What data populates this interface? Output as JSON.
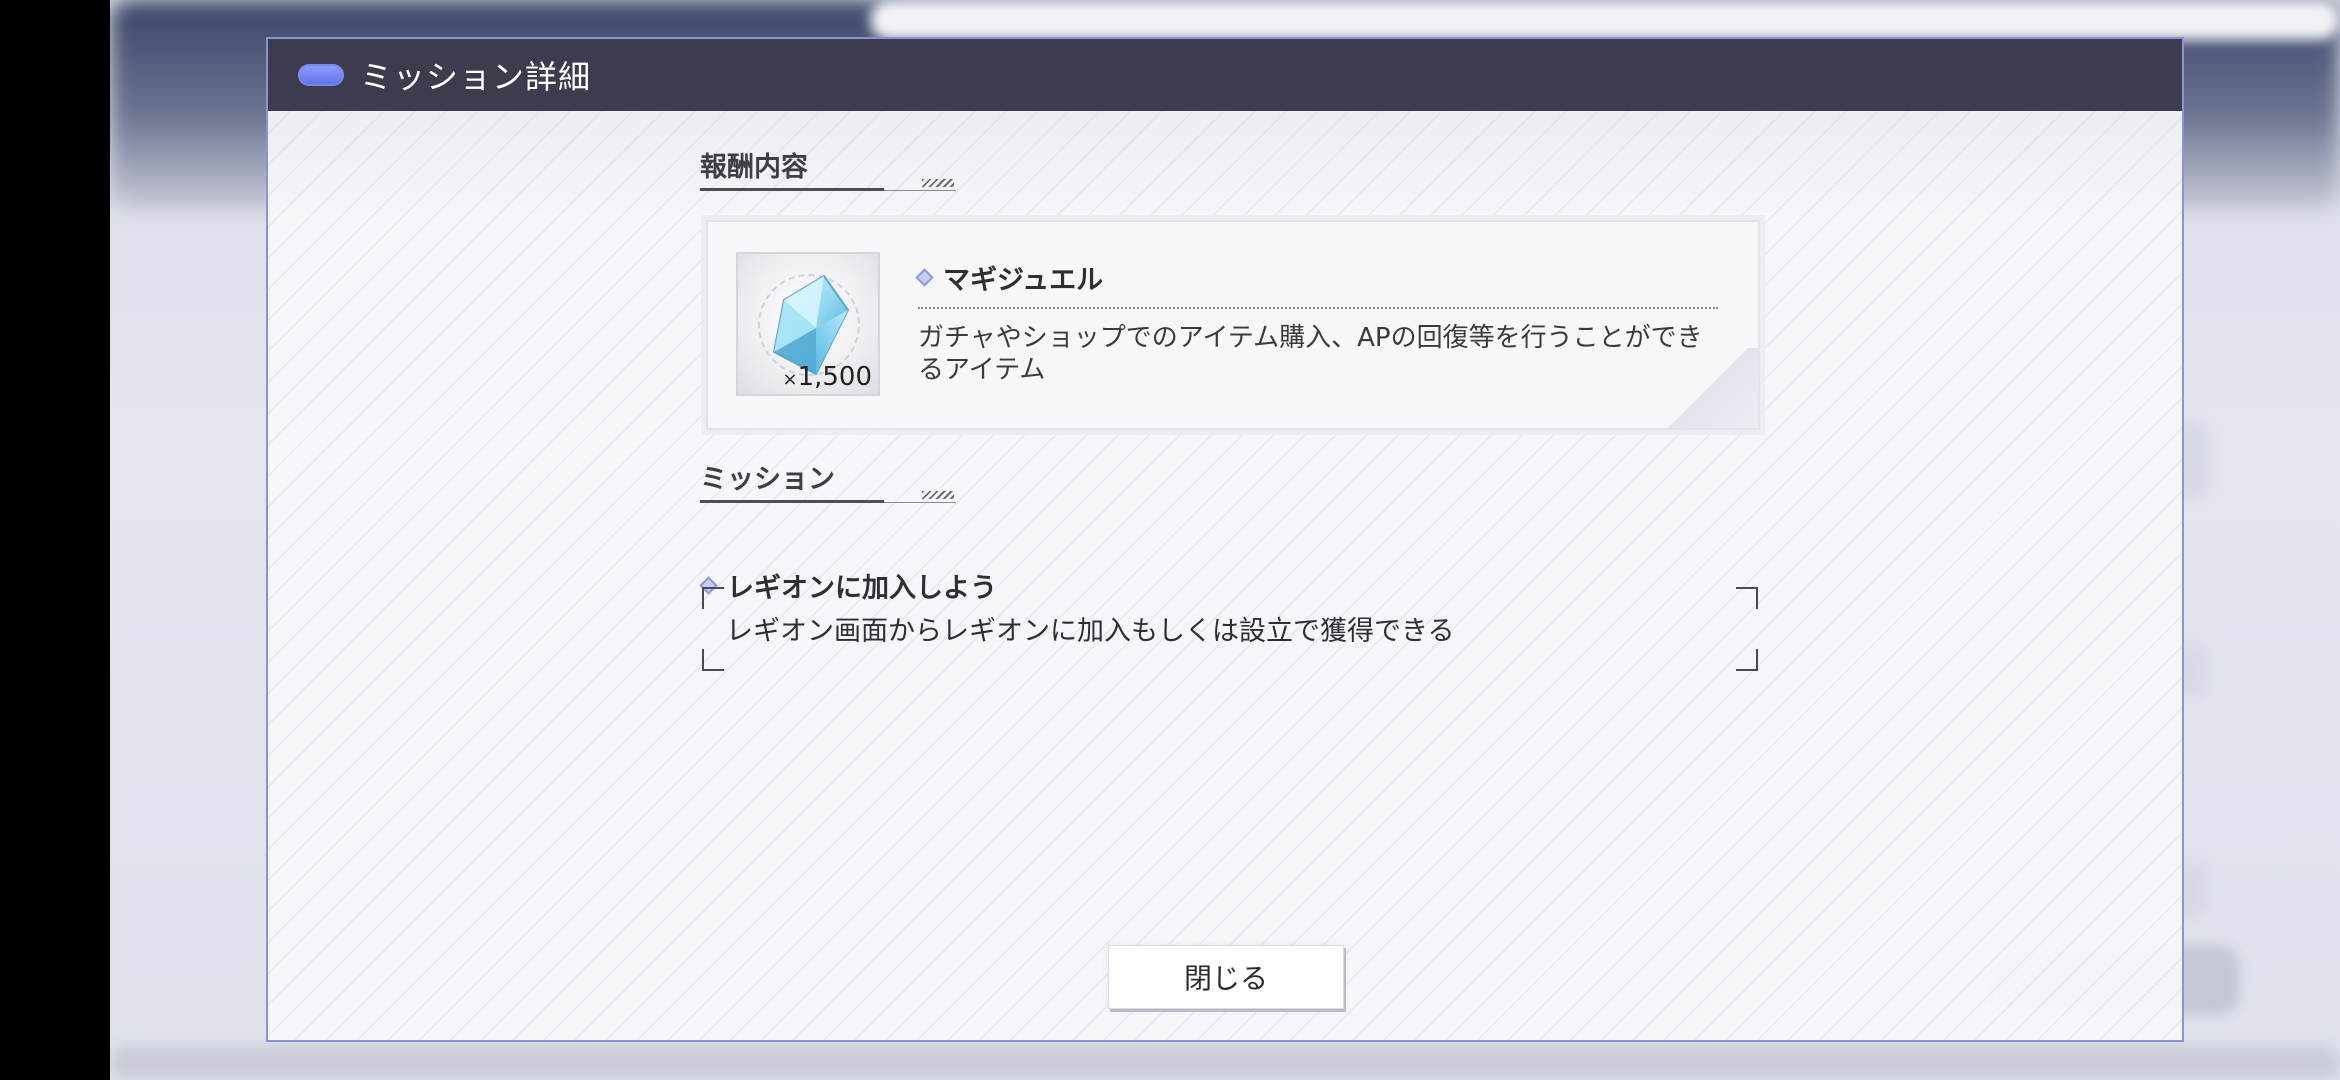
{
  "dialog": {
    "title": "ミッション詳細"
  },
  "reward_section": {
    "heading": "報酬内容",
    "item": {
      "icon": "crystal-gem-icon",
      "quantity": "1,500",
      "quantity_prefix": "×",
      "name": "マギジュエル",
      "description": "ガチャやショップでのアイテム購入、APの回復等を行うことができるアイテム"
    }
  },
  "mission_section": {
    "heading": "ミッション",
    "mission_name": "レギオンに加入しよう",
    "mission_description": "レギオン画面からレギオンに加入もしくは設立で獲得できる"
  },
  "close_button": {
    "label": "閉じる"
  },
  "colors": {
    "header_bg": "#3c3c4e",
    "modal_border": "#8d92d6",
    "accent": "#8c99e6"
  }
}
